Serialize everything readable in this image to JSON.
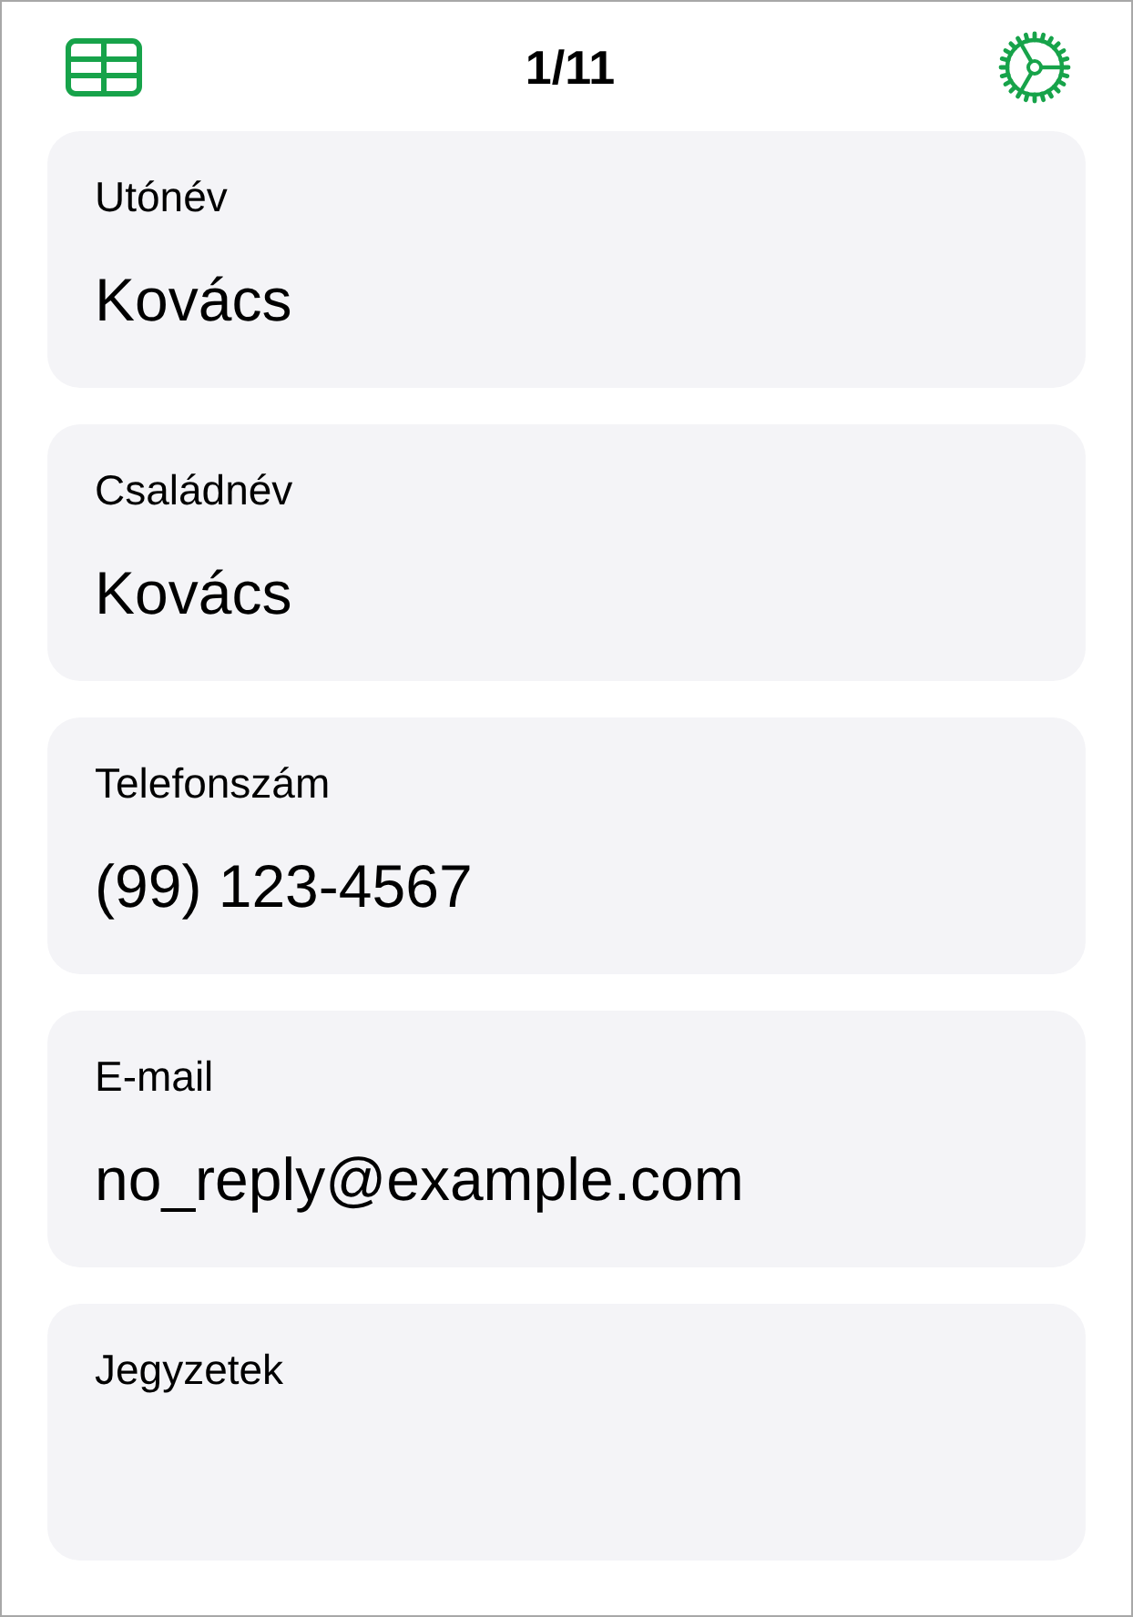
{
  "header": {
    "title": "1/11"
  },
  "fields": [
    {
      "label": "Utónév",
      "value": "Kovács"
    },
    {
      "label": "Családnév",
      "value": "Kovács"
    },
    {
      "label": "Telefonszám",
      "value": "(99) 123-4567"
    },
    {
      "label": "E-mail",
      "value": "no_reply@example.com"
    },
    {
      "label": "Jegyzetek"
    }
  ]
}
